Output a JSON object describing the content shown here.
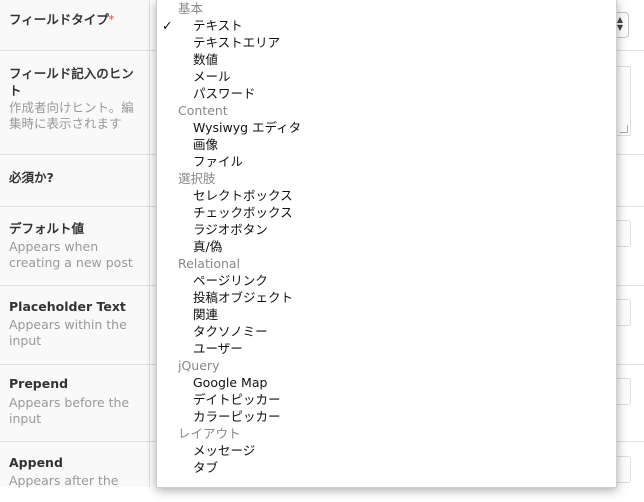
{
  "fields": [
    {
      "label": "フィールドタイプ",
      "required_mark": "*",
      "desc": ""
    },
    {
      "label": "フィールド記入のヒント",
      "required_mark": "",
      "desc": "作成者向けヒント。編集時に表示されます"
    },
    {
      "label": "必須か?",
      "required_mark": "",
      "desc": ""
    },
    {
      "label": "デフォルト値",
      "required_mark": "",
      "desc": "Appears when creating a new post"
    },
    {
      "label": "Placeholder Text",
      "required_mark": "",
      "desc": "Appears within the input"
    },
    {
      "label": "Prepend",
      "required_mark": "",
      "desc": "Appears before the input"
    },
    {
      "label": "Append",
      "required_mark": "",
      "desc": "Appears after the"
    }
  ],
  "dropdown": {
    "selected": "テキスト",
    "check_mark": "✓",
    "groups": [
      {
        "label": "基本",
        "options": [
          "テキスト",
          "テキストエリア",
          "数値",
          "メール",
          "パスワード"
        ]
      },
      {
        "label": "Content",
        "options": [
          "Wysiwyg エディタ",
          "画像",
          "ファイル"
        ]
      },
      {
        "label": "選択肢",
        "options": [
          "セレクトボックス",
          "チェックボックス",
          "ラジオボタン",
          "真/偽"
        ]
      },
      {
        "label": "Relational",
        "options": [
          "ページリンク",
          "投稿オブジェクト",
          "関連",
          "タクソノミー",
          "ユーザー"
        ]
      },
      {
        "label": "jQuery",
        "options": [
          "Google Map",
          "デイトピッカー",
          "カラーピッカー"
        ]
      },
      {
        "label": "レイアウト",
        "options": [
          "メッセージ",
          "タブ"
        ]
      }
    ]
  },
  "colors": {
    "required": "#dd3d36",
    "label_bg": "#f9f9f9",
    "border": "#e1e1e1"
  }
}
